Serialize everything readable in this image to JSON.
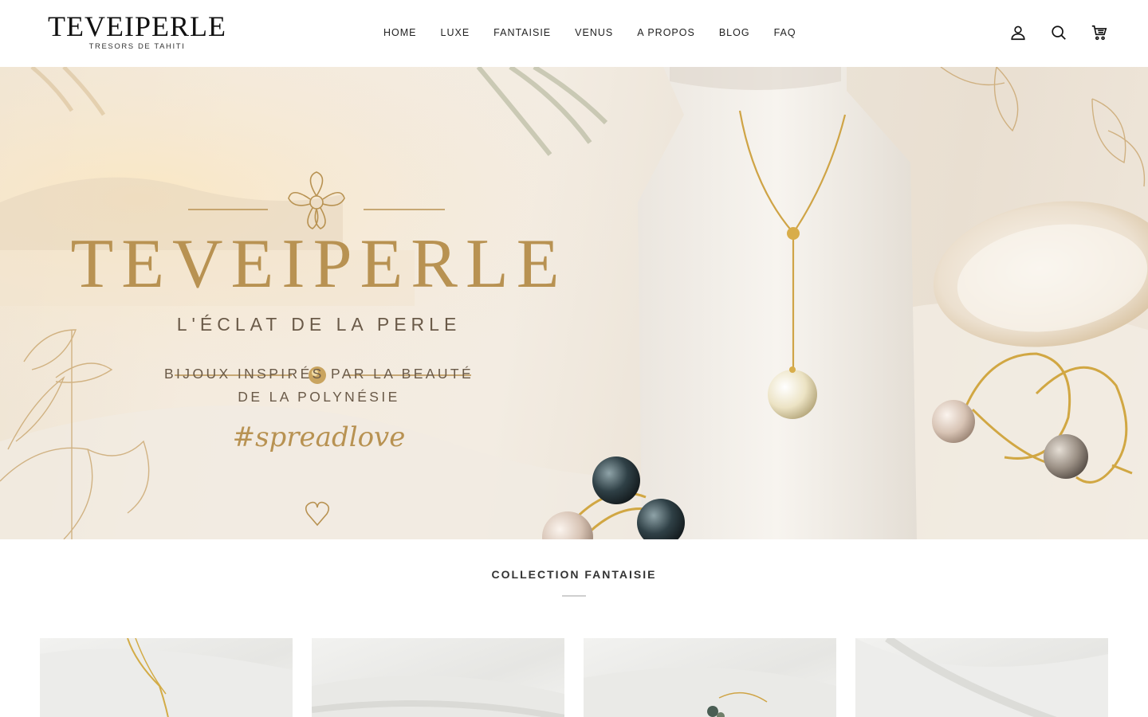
{
  "header": {
    "logo_main": "TEVEIPERLE",
    "logo_sub": "TRESORS DE TAHITI",
    "nav": [
      "HOME",
      "LUXE",
      "FANTAISIE",
      "VENUS",
      "A PROPOS",
      "BLOG",
      "FAQ"
    ],
    "icons": [
      "account-icon",
      "search-icon",
      "cart-icon"
    ]
  },
  "hero": {
    "brand": "TEVEIPERLE",
    "tagline": "L'ÉCLAT DE LA PERLE",
    "subtitle_line1": "BIJOUX INSPIRÉS PAR LA BEAUTÉ",
    "subtitle_line2": "DE LA POLYNÉSIE",
    "hashtag": "#spreadlove",
    "accent_color": "#b89252"
  },
  "collection": {
    "title": "COLLECTION FANTAISIE",
    "products": [
      {},
      {},
      {},
      {}
    ]
  }
}
